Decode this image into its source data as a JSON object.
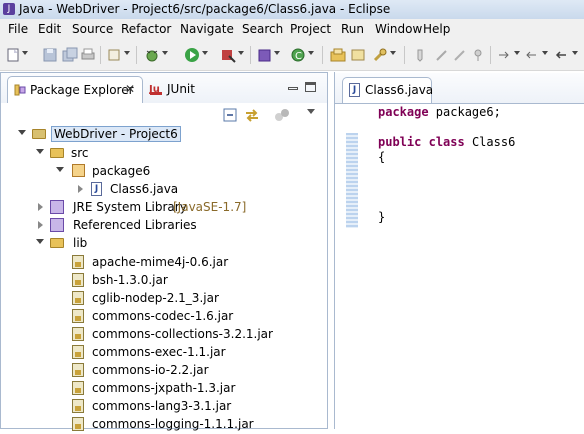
{
  "window": {
    "title": "Java - WebDriver - Project6/src/package6/Class6.java - Eclipse"
  },
  "menu": [
    "File",
    "Edit",
    "Source",
    "Refactor",
    "Navigate",
    "Search",
    "Project",
    "Run",
    "Window",
    "Help"
  ],
  "left_tabs": {
    "active": "Package Explorer",
    "second": "JUnit"
  },
  "tree": {
    "project": "WebDriver - Project6",
    "src": "src",
    "package": "package6",
    "file": "Class6.java",
    "jre": "JRE System Library",
    "jre_version": "[JavaSE-1.7]",
    "ref_libs": "Referenced Libraries",
    "lib": "lib",
    "jars": [
      "apache-mime4j-0.6.jar",
      "bsh-1.3.0.jar",
      "cglib-nodep-2.1_3.jar",
      "commons-codec-1.6.jar",
      "commons-collections-3.2.1.jar",
      "commons-exec-1.1.jar",
      "commons-io-2.2.jar",
      "commons-jxpath-1.3.jar",
      "commons-lang3-3.1.jar",
      "commons-logging-1.1.1.jar"
    ]
  },
  "editor": {
    "tab": "Class6.java",
    "line1_kw": "package",
    "line1_rest": " package6;",
    "line2_kw1": "public",
    "line2_kw2": "class",
    "line2_rest": " Class6",
    "open_brace": "{",
    "close_brace": "}"
  },
  "colors": {
    "keyword": "#7f0055",
    "selection_border": "#7da2ce",
    "title_bar": "#c9d9ec"
  }
}
